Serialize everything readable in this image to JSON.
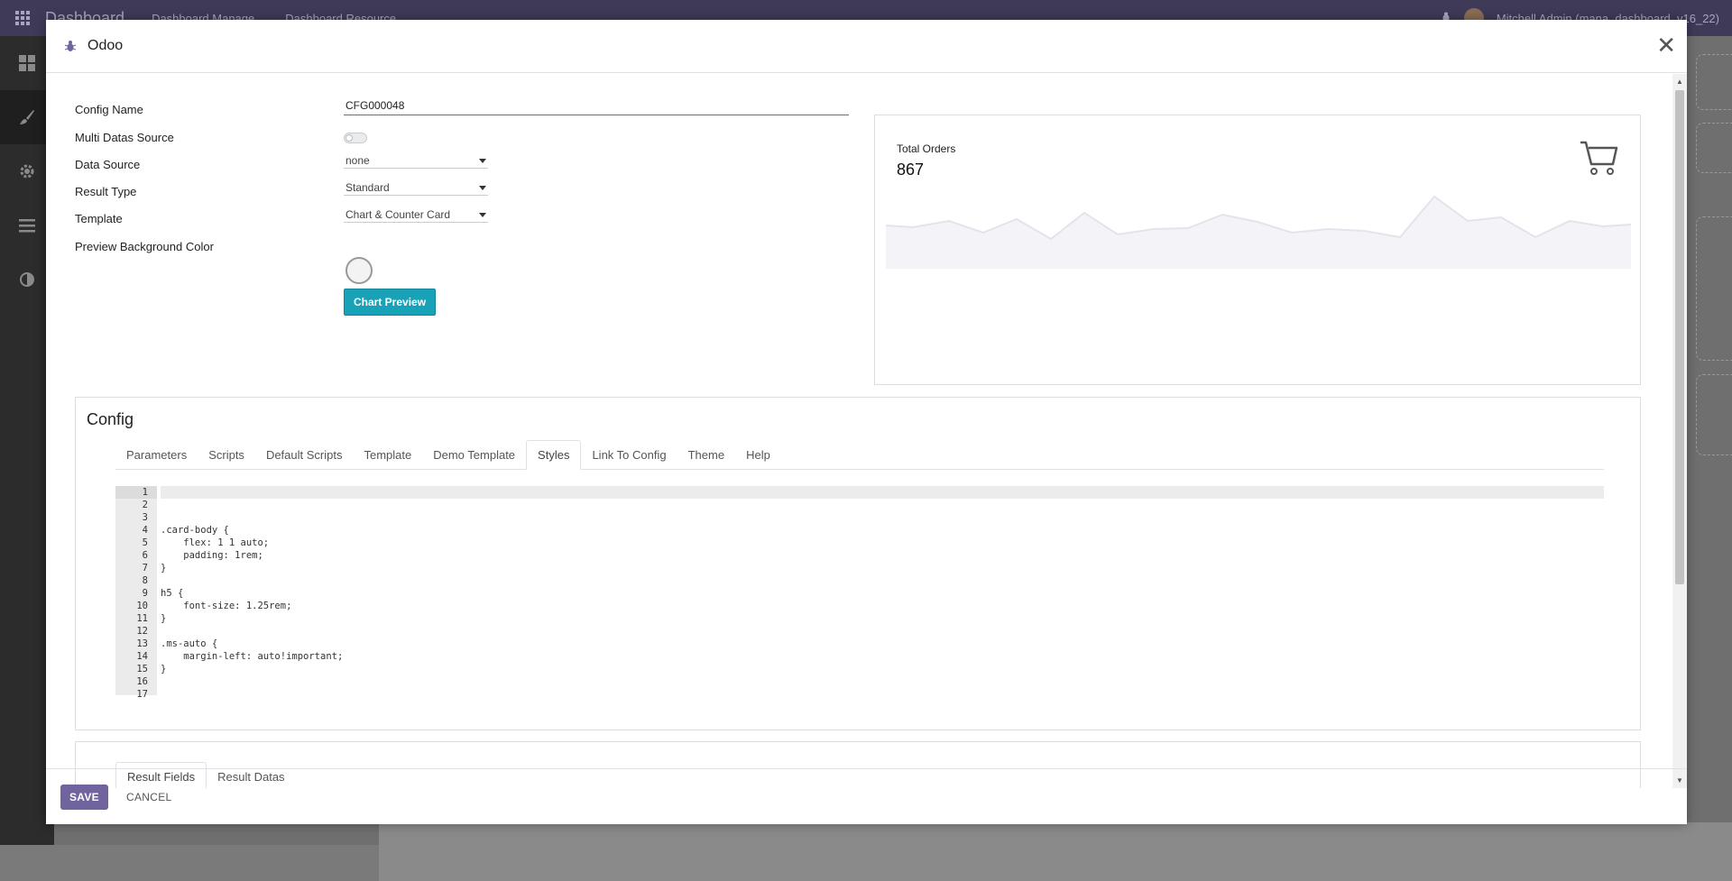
{
  "topbar": {
    "brand": "Dashboard",
    "menus": [
      "Dashboard Manage",
      "Dashboard Resource"
    ],
    "user": "Mitchell Admin (mana_dashboard_v16_22)"
  },
  "sidebar": {
    "icons": [
      "dashboard-icon",
      "brush-icon",
      "gear-icon",
      "list-icon",
      "contrast-icon"
    ]
  },
  "modal": {
    "title": "Odoo",
    "form": {
      "config_name_label": "Config Name",
      "config_name_value": "CFG000048",
      "multi_source_label": "Multi Datas Source",
      "multi_source_value": false,
      "data_source_label": "Data Source",
      "data_source_value": "none",
      "result_type_label": "Result Type",
      "result_type_value": "Standard",
      "template_label": "Template",
      "template_value": "Chart & Counter Card",
      "preview_bg_label": "Preview Background Color",
      "preview_button": "Chart Preview"
    },
    "preview": {
      "title": "Total Orders",
      "value": "867"
    },
    "config": {
      "title": "Config",
      "tabs": [
        "Parameters",
        "Scripts",
        "Default Scripts",
        "Template",
        "Demo Template",
        "Styles",
        "Link To Config",
        "Theme",
        "Help"
      ],
      "active_tab": "Styles",
      "code_lines": [
        "",
        "",
        "",
        ".card-body {",
        "    flex: 1 1 auto;",
        "    padding: 1rem;",
        "}",
        "",
        "h5 {",
        "    font-size: 1.25rem;",
        "}",
        "",
        ".ms-auto {",
        "    margin-left: auto!important;",
        "}",
        "",
        ""
      ]
    },
    "result": {
      "tabs": [
        "Result Fields",
        "Result Datas"
      ],
      "active_tab": "Result Fields"
    },
    "footer": {
      "save": "SAVE",
      "cancel": "CANCEL"
    }
  },
  "colors": {
    "topbar": "#3f3a58",
    "primary": "#71639e",
    "preview_button": "#17a2b8"
  }
}
